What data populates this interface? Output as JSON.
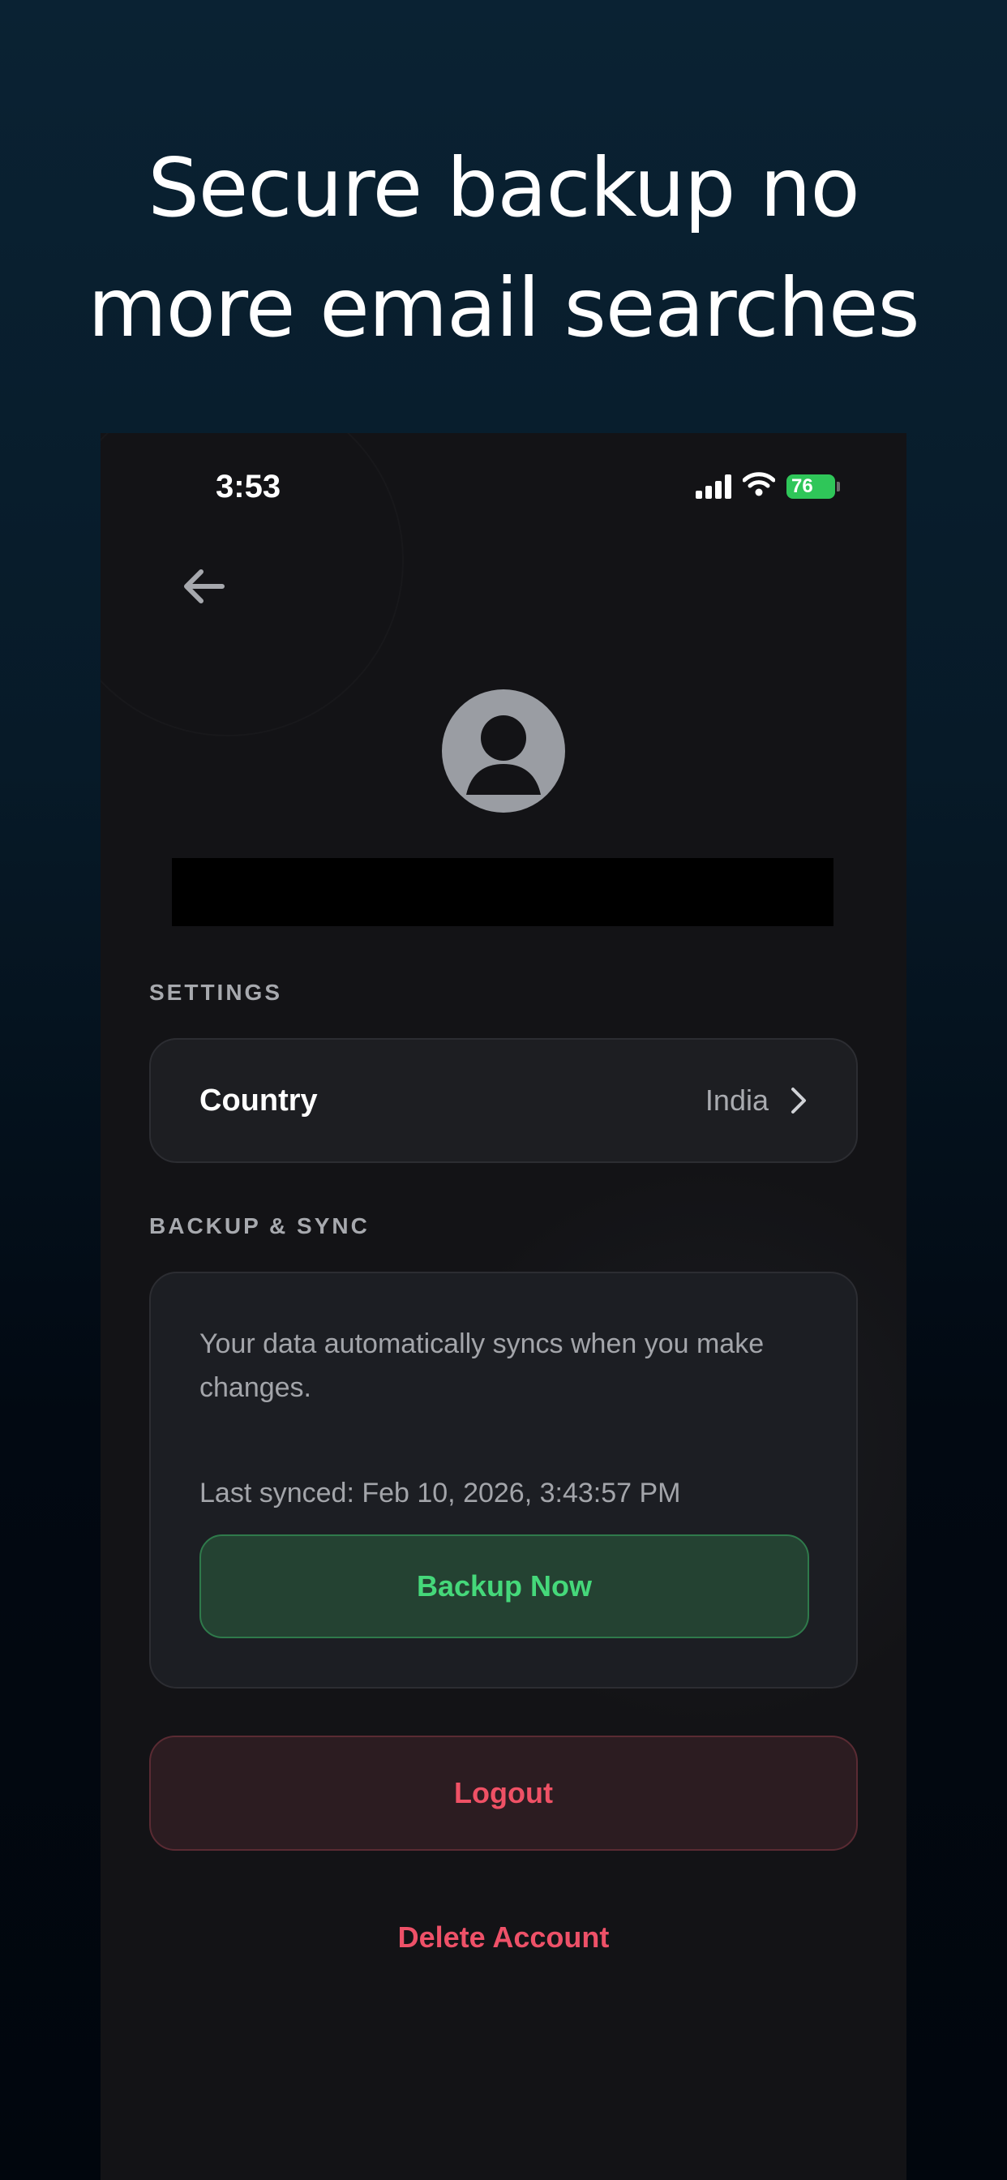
{
  "headline": {
    "line1": "Secure backup no",
    "line2": "more email searches"
  },
  "status_bar": {
    "time": "3:53",
    "battery": "76",
    "icons": [
      "signal-icon",
      "wifi-icon",
      "battery-charging-icon"
    ]
  },
  "nav": {
    "back_icon": "arrow-left-icon"
  },
  "profile": {
    "avatar_icon": "user-avatar-icon"
  },
  "settings": {
    "section_label": "SETTINGS",
    "country_label": "Country",
    "country_value": "India",
    "chevron_icon": "chevron-right-icon"
  },
  "backup": {
    "section_label": "BACKUP & SYNC",
    "description": "Your data automatically syncs when you make changes.",
    "last_synced": "Last synced: Feb 10, 2026, 3:43:57 PM",
    "button_label": "Backup Now"
  },
  "actions": {
    "logout_label": "Logout",
    "delete_label": "Delete Account"
  },
  "colors": {
    "accent_green": "#45d87a",
    "danger_red": "#ef5165",
    "battery_green": "#2fc659"
  }
}
